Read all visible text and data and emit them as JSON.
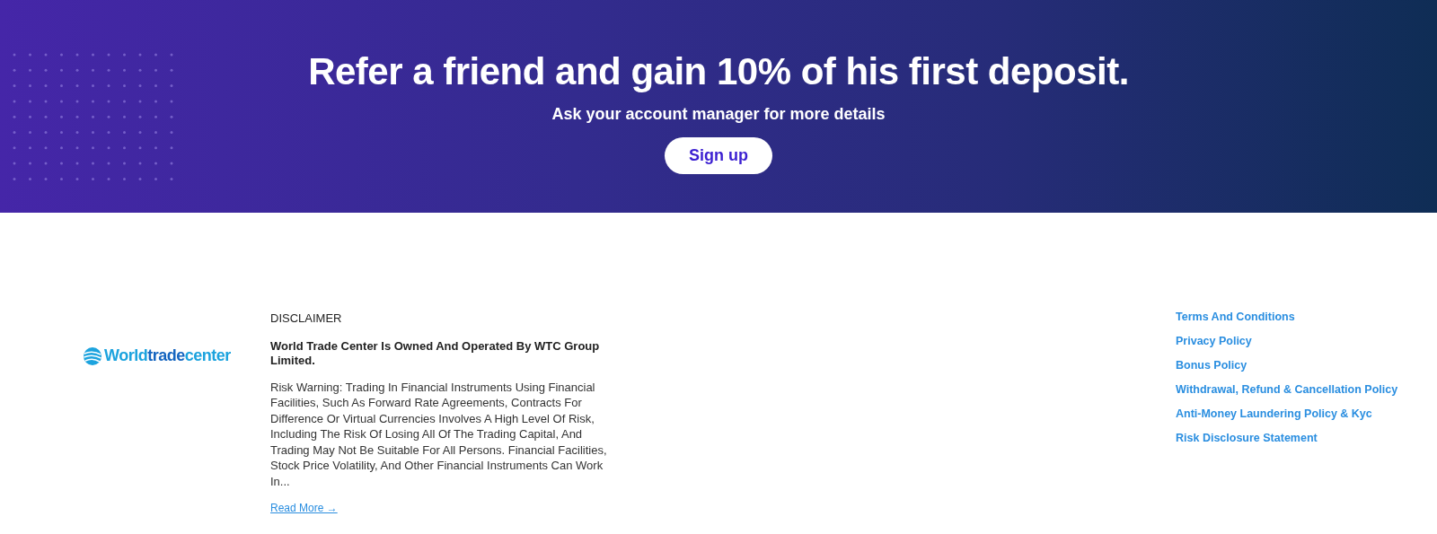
{
  "banner": {
    "title": "Refer a friend and gain 10% of his first deposit.",
    "subtitle": "Ask your account manager for more details",
    "button": "Sign up"
  },
  "logo": [
    {
      "text": "World",
      "color": "#1ca3de"
    },
    {
      "text": "trade",
      "color": "#1565c0"
    },
    {
      "text": "center",
      "color": "#1ca3de"
    }
  ],
  "disclaimer": {
    "heading": "DISCLAIMER",
    "owner": "World Trade Center Is Owned And Operated By WTC Group Limited.",
    "risk": "Risk Warning: Trading In Financial Instruments Using Financial Facilities, Such As Forward Rate Agreements, Contracts For Difference Or Virtual Currencies Involves A High Level Of Risk, Including The Risk Of Losing All Of The Trading Capital, And Trading May Not Be Suitable For All Persons. Financial Facilities, Stock Price Volatility, And Other Financial Instruments Can Work In...",
    "read_more": "Read More →"
  },
  "links": [
    "Terms And Conditions",
    "Privacy Policy",
    "Bonus Policy",
    "Withdrawal, Refund & Cancellation Policy",
    "Anti-Money Laundering Policy & Kyc",
    "Risk Disclosure Statement"
  ]
}
